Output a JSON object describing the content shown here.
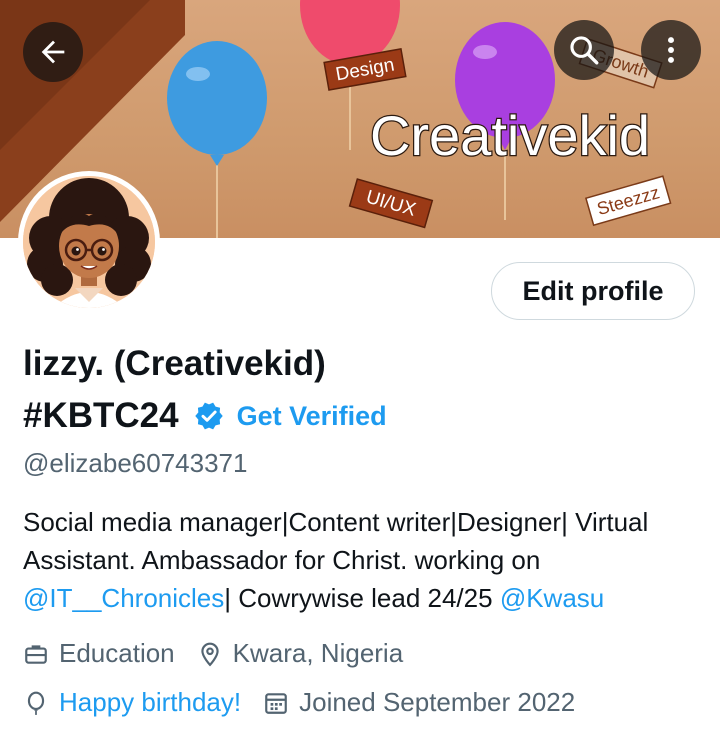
{
  "banner": {
    "title": "Creativekid",
    "tags": [
      "Design",
      "Growth",
      "UI/UX",
      "Steezzz"
    ]
  },
  "header": {
    "back_icon": "arrow-left-icon",
    "search_icon": "search-icon",
    "more_icon": "more-vertical-icon"
  },
  "profile": {
    "edit_label": "Edit profile",
    "name_line1": "lizzy. (Creativekid)",
    "name_line2": "#KBTC24",
    "get_verified": "Get Verified",
    "handle": "@elizabe60743371",
    "bio": {
      "part1": "Social media manager|Content writer|Designer| Virtual Assistant. Ambassador for Christ. working on ",
      "mention1": "@IT__Chronicles",
      "part2": "| Cowrywise lead 24/25 ",
      "mention2": "@Kwasu"
    },
    "category": "Education",
    "location": "Kwara, Nigeria",
    "birthday": "Happy birthday!",
    "joined": "Joined September 2022"
  },
  "colors": {
    "accent": "#1d9bf0",
    "secondary_text": "#536471",
    "primary_text": "#0f1419"
  }
}
